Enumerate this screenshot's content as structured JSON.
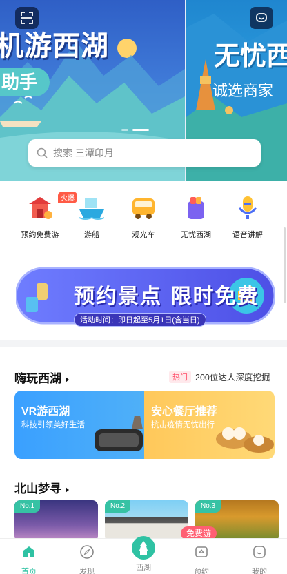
{
  "hero": {
    "slide_a_title": "机游西湖",
    "slide_a_subtitle": "助手",
    "slide_b_title": "无忧西",
    "slide_b_subtitle": "诚选商家",
    "left_icon": "scan-icon",
    "right_icon": "message-icon",
    "slides_total": 2,
    "active_slide": 2
  },
  "search": {
    "icon": "search-icon",
    "placeholder": "搜索 三潭印月"
  },
  "quick_menu": [
    {
      "label": "预约免费游",
      "icon": "temple-icon",
      "badge": "火爆"
    },
    {
      "label": "游船",
      "icon": "boat-icon"
    },
    {
      "label": "观光车",
      "icon": "bus-icon"
    },
    {
      "label": "无忧西湖",
      "icon": "bag-icon"
    },
    {
      "label": "语音讲解",
      "icon": "microphone-icon"
    }
  ],
  "promo_banner": {
    "title": "预约景点  限时免费",
    "date": "活动时间：即日起至5月1日(含当日)"
  },
  "section_play": {
    "title": "嗨玩西湖",
    "tag": "热门",
    "desc": "200位达人深度挖掘",
    "cards": [
      {
        "title": "VR游西湖",
        "subtitle": "科技引领美好生活"
      },
      {
        "title": "安心餐厅推荐",
        "subtitle": "抗击疫情无忧出行"
      }
    ]
  },
  "section_north": {
    "title": "北山梦寻",
    "tiles": [
      {
        "rank": "No.1"
      },
      {
        "rank": "No.2"
      },
      {
        "rank": "No.3"
      }
    ],
    "free_tag": "免费游"
  },
  "tabbar": {
    "items": [
      {
        "label": "首页",
        "icon": "home-icon",
        "active": true
      },
      {
        "label": "发现",
        "icon": "compass-icon",
        "active": false
      },
      {
        "label": "西湖",
        "icon": "pagoda-icon",
        "active": false
      },
      {
        "label": "预约",
        "icon": "ticket-icon",
        "active": false
      },
      {
        "label": "我的",
        "icon": "user-icon",
        "active": false
      }
    ]
  },
  "colors": {
    "brand": "#2fc2a3",
    "hot": "#ff5a45",
    "vr_card": "#3aa0ff",
    "food_card": "#ffc85a"
  }
}
